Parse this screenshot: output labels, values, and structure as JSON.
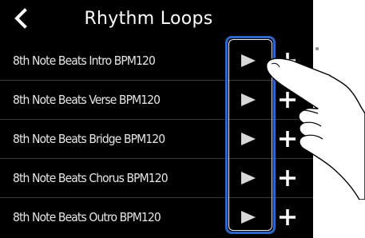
{
  "header": {
    "title": "Rhythm Loops",
    "back_icon": "chevron-left-icon"
  },
  "loops": [
    {
      "label": "8th Note Beats Intro BPM120"
    },
    {
      "label": "8th Note Beats Verse BPM120"
    },
    {
      "label": "8th Note Beats Bridge BPM120"
    },
    {
      "label": "8th Note Beats Chorus BPM120"
    },
    {
      "label": "8th Note Beats Outro BPM120"
    }
  ],
  "icons": {
    "play": "play-icon",
    "add": "plus-icon"
  },
  "colors": {
    "background": "#000000",
    "text": "#e6e6e6",
    "highlight": "#2f65c9",
    "divider": "#3a3a3a"
  }
}
